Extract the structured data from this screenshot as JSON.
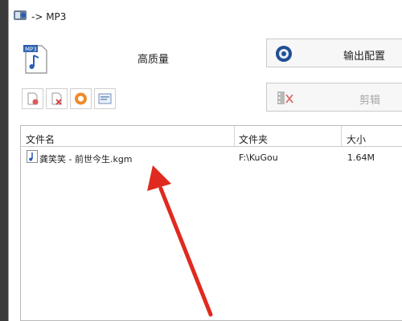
{
  "window": {
    "title": "-> MP3"
  },
  "quality": "高质量",
  "buttons": {
    "output_config": "输出配置",
    "trim": "剪辑"
  },
  "toolbar": {
    "icons": [
      "add-file-icon",
      "remove-file-icon",
      "play-icon",
      "file-info-icon"
    ]
  },
  "table": {
    "columns": [
      "文件名",
      "文件夹",
      "大小"
    ],
    "rows": [
      {
        "name": "龚笑笑 - 前世今生.kgm",
        "folder": "F:\\KuGou",
        "size": "1.64M"
      }
    ]
  },
  "colors": {
    "annotation_arrow": "#e02a1f",
    "accent_blue": "#2a5fb0",
    "window_bg": "#ffffff"
  }
}
